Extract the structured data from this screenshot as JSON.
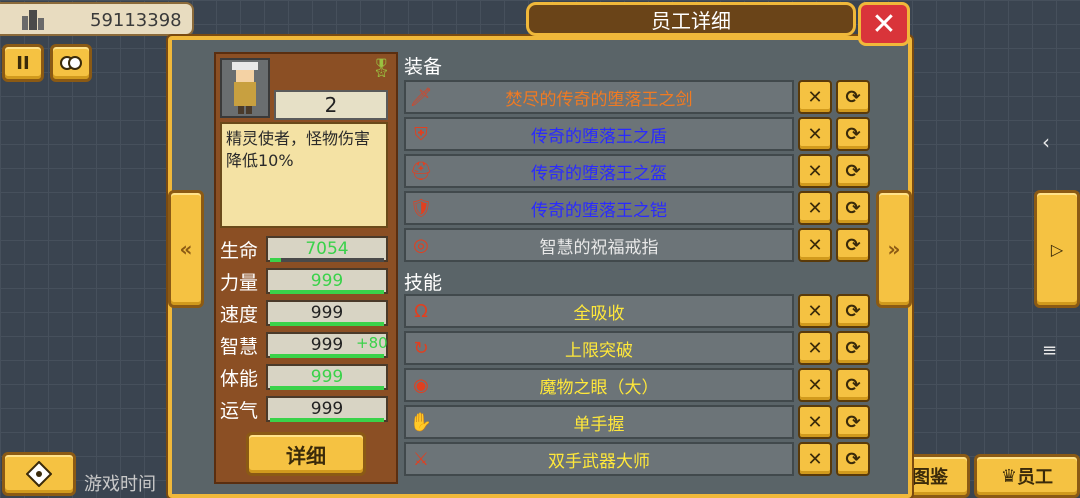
{
  "topbar": {
    "money_value": "59113398"
  },
  "hud": {
    "pause_label": "II",
    "game_time_label": "游戏时间",
    "atlas_label": "图鉴",
    "staff_label": "员工"
  },
  "dialog": {
    "title": "员工详细",
    "close_icon": "✕"
  },
  "employee": {
    "level": "2",
    "description": "精灵使者，怪物伤害降低10%",
    "detail_button": "详细",
    "stats": [
      {
        "label": "生命",
        "value": "7054",
        "bonus": "",
        "bar": 0.1,
        "value_color": "#3ad24a"
      },
      {
        "label": "力量",
        "value": "999",
        "bonus": "",
        "bar": 1.0,
        "value_color": "#3ad24a"
      },
      {
        "label": "速度",
        "value": "999",
        "bonus": "",
        "bar": 1.0,
        "value_color": "#222222"
      },
      {
        "label": "智慧",
        "value": "999",
        "bonus": "+80",
        "bar": 1.0,
        "value_color": "#222222"
      },
      {
        "label": "体能",
        "value": "999",
        "bonus": "",
        "bar": 1.0,
        "value_color": "#3ad24a"
      },
      {
        "label": "运气",
        "value": "999",
        "bonus": "",
        "bar": 1.0,
        "value_color": "#222222"
      }
    ]
  },
  "equipment": {
    "title": "装备",
    "items": [
      {
        "label": "焚尽的传奇的堕落王之剑",
        "color": "#f07a22",
        "icon": "sword-icon"
      },
      {
        "label": "传奇的堕落王之盾",
        "color": "#2a2aff",
        "icon": "shield-icon"
      },
      {
        "label": "传奇的堕落王之盔",
        "color": "#2a2aff",
        "icon": "helmet-icon"
      },
      {
        "label": "传奇的堕落王之铠",
        "color": "#2a2aff",
        "icon": "armor-icon"
      },
      {
        "label": "智慧的祝福戒指",
        "color": "#e8e8e8",
        "icon": "ring-icon"
      }
    ]
  },
  "skills": {
    "title": "技能",
    "items": [
      {
        "label": "全吸收",
        "color": "#ffe83a",
        "icon": "absorb-icon"
      },
      {
        "label": "上限突破",
        "color": "#ffe83a",
        "icon": "breakthrough-icon"
      },
      {
        "label": "魔物之眼（大）",
        "color": "#ffe83a",
        "icon": "eye-icon"
      },
      {
        "label": "单手握",
        "color": "#ffe83a",
        "icon": "one-hand-icon"
      },
      {
        "label": "双手武器大师",
        "color": "#ffe83a",
        "icon": "two-hand-icon"
      }
    ]
  }
}
